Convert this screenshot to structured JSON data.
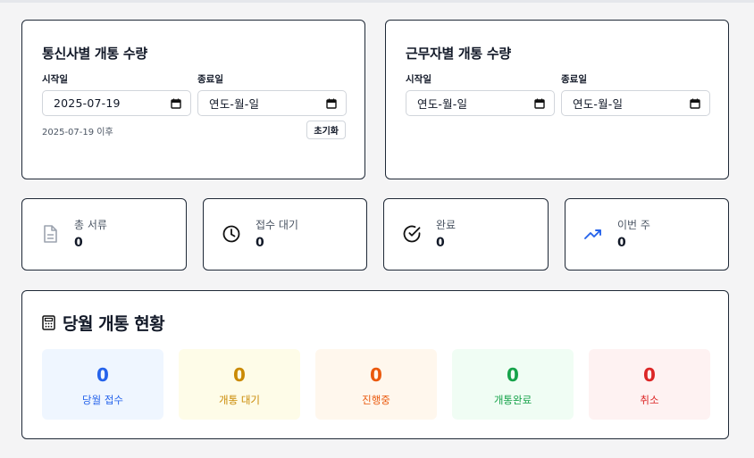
{
  "carrier_panel": {
    "title": "통신사별 개통 수량",
    "start_label": "시작일",
    "end_label": "종료일",
    "start_value": "2025-07-19",
    "end_value": "연도-월-일",
    "hint": "2025-07-19 이후",
    "reset_label": "초기화"
  },
  "worker_panel": {
    "title": "근무자별 개통 수량",
    "start_label": "시작일",
    "end_label": "종료일",
    "start_value": "연도-월-일",
    "end_value": "연도-월-일"
  },
  "stats": [
    {
      "label": "총 서류",
      "value": "0",
      "icon": "document-icon"
    },
    {
      "label": "접수 대기",
      "value": "0",
      "icon": "clock-icon"
    },
    {
      "label": "완료",
      "value": "0",
      "icon": "check-circle-icon"
    },
    {
      "label": "이번 주",
      "value": "0",
      "icon": "trending-up-icon"
    }
  ],
  "month": {
    "title": "당월 개통 현황",
    "icon": "calculator-icon",
    "tiles": [
      {
        "value": "0",
        "label": "당월 접수",
        "color": "#2563eb",
        "bg": "#eff6ff"
      },
      {
        "value": "0",
        "label": "개통 대기",
        "color": "#ca8a04",
        "bg": "#fefce8"
      },
      {
        "value": "0",
        "label": "진행중",
        "color": "#ea580c",
        "bg": "#fff7ed"
      },
      {
        "value": "0",
        "label": "개통완료",
        "color": "#16a34a",
        "bg": "#f0fdf4"
      },
      {
        "value": "0",
        "label": "취소",
        "color": "#dc2626",
        "bg": "#fef2f2"
      }
    ]
  }
}
